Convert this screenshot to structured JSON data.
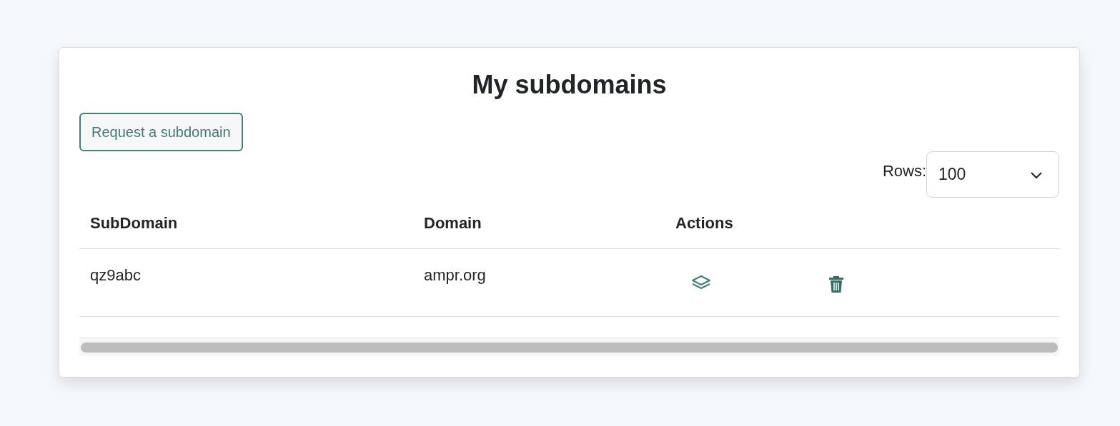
{
  "title": "My subdomains",
  "request_button": "Request a subdomain",
  "rows_selector": {
    "label": "Rows:",
    "value": "100"
  },
  "table": {
    "columns": [
      "SubDomain",
      "Domain",
      "Actions"
    ],
    "rows": [
      {
        "subdomain": "qz9abc",
        "domain": "ampr.org"
      }
    ]
  }
}
